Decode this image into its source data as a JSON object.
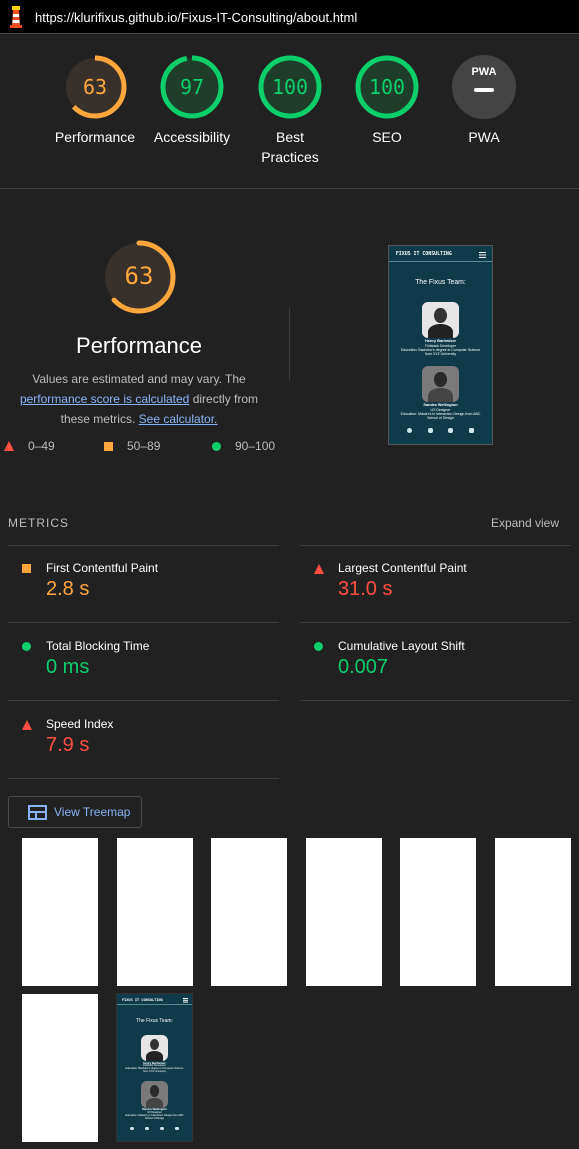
{
  "url": "https://klurifixus.github.io/Fixus-IT-Consulting/about.html",
  "gauges": [
    {
      "score": "63",
      "label": "Performance",
      "color": "#ffa63d",
      "fraction": 0.63
    },
    {
      "score": "97",
      "label": "Accessibility",
      "color": "#0cce6b",
      "fraction": 0.97
    },
    {
      "score": "100",
      "label": "Best Practices",
      "color": "#0cce6b",
      "fraction": 1.0
    },
    {
      "score": "100",
      "label": "SEO",
      "color": "#0cce6b",
      "fraction": 1.0
    },
    {
      "score": "PWA",
      "label": "PWA",
      "color": "#9e9e9e",
      "fraction": 0
    }
  ],
  "performance": {
    "score": "63",
    "title": "Performance",
    "desc_1": "Values are estimated and may vary. The",
    "desc_link": "performance score is calculated",
    "desc_2": "directly from these metrics.",
    "calc_link": "See calculator."
  },
  "legend": {
    "fail": "0–49",
    "average": "50–89",
    "pass": "90–100"
  },
  "phone": {
    "brand": "FIXUS IT CONSULTING",
    "heading": "The Fixus Team:",
    "p1_name": "Henry Barhwiser",
    "p1_role": "Fullstack Developer",
    "p1_edu": "Education: Bachelor's degree in Computer Science from XYZ University",
    "p2_name": "Sandra Wellington",
    "p2_role": "UX Designer",
    "p2_edu": "Education: Master's in Interaction Design from ABC School of Design"
  },
  "metrics": {
    "header": "METRICS",
    "expand": "Expand view",
    "items": [
      {
        "name": "First Contentful Paint",
        "value": "2.8 s",
        "status": "average",
        "color": "#ffa63d"
      },
      {
        "name": "Largest Contentful Paint",
        "value": "31.0 s",
        "status": "fail",
        "color": "#ff4e42"
      },
      {
        "name": "Total Blocking Time",
        "value": "0 ms",
        "status": "pass",
        "color": "#0cce6b"
      },
      {
        "name": "Cumulative Layout Shift",
        "value": "0.007",
        "status": "pass",
        "color": "#0cce6b"
      },
      {
        "name": "Speed Index",
        "value": "7.9 s",
        "status": "fail",
        "color": "#ff4e42"
      }
    ]
  },
  "treemap": {
    "label": "View Treemap"
  }
}
